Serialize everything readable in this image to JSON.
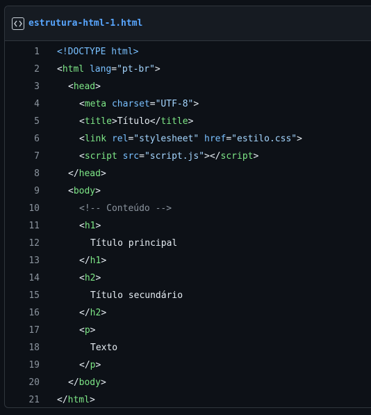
{
  "file": {
    "icon": "code-icon",
    "name": "estrutura-html-1.html"
  },
  "lines": [
    {
      "n": "1",
      "indent": 0,
      "tokens": [
        [
          "a",
          "<!DOCTYPE html>"
        ]
      ]
    },
    {
      "n": "2",
      "indent": 0,
      "tokens": [
        [
          "p",
          "<"
        ],
        [
          "t",
          "html"
        ],
        [
          "p",
          " "
        ],
        [
          "a",
          "lang"
        ],
        [
          "p",
          "="
        ],
        [
          "s",
          "\"pt-br\""
        ],
        [
          "p",
          ">"
        ]
      ]
    },
    {
      "n": "3",
      "indent": 2,
      "tokens": [
        [
          "p",
          "<"
        ],
        [
          "t",
          "head"
        ],
        [
          "p",
          ">"
        ]
      ]
    },
    {
      "n": "4",
      "indent": 4,
      "tokens": [
        [
          "p",
          "<"
        ],
        [
          "t",
          "meta"
        ],
        [
          "p",
          " "
        ],
        [
          "a",
          "charset"
        ],
        [
          "p",
          "="
        ],
        [
          "s",
          "\"UTF-8\""
        ],
        [
          "p",
          ">"
        ]
      ]
    },
    {
      "n": "5",
      "indent": 4,
      "tokens": [
        [
          "p",
          "<"
        ],
        [
          "t",
          "title"
        ],
        [
          "p",
          ">Título</"
        ],
        [
          "t",
          "title"
        ],
        [
          "p",
          ">"
        ]
      ]
    },
    {
      "n": "6",
      "indent": 4,
      "tokens": [
        [
          "p",
          "<"
        ],
        [
          "t",
          "link"
        ],
        [
          "p",
          " "
        ],
        [
          "a",
          "rel"
        ],
        [
          "p",
          "="
        ],
        [
          "s",
          "\"stylesheet\""
        ],
        [
          "p",
          " "
        ],
        [
          "a",
          "href"
        ],
        [
          "p",
          "="
        ],
        [
          "s",
          "\"estilo.css\""
        ],
        [
          "p",
          ">"
        ]
      ]
    },
    {
      "n": "7",
      "indent": 4,
      "tokens": [
        [
          "p",
          "<"
        ],
        [
          "t",
          "script"
        ],
        [
          "p",
          " "
        ],
        [
          "a",
          "src"
        ],
        [
          "p",
          "="
        ],
        [
          "s",
          "\"script.js\""
        ],
        [
          "p",
          "></"
        ],
        [
          "t",
          "script"
        ],
        [
          "p",
          ">"
        ]
      ]
    },
    {
      "n": "8",
      "indent": 2,
      "tokens": [
        [
          "p",
          "</"
        ],
        [
          "t",
          "head"
        ],
        [
          "p",
          ">"
        ]
      ]
    },
    {
      "n": "9",
      "indent": 2,
      "tokens": [
        [
          "p",
          "<"
        ],
        [
          "t",
          "body"
        ],
        [
          "p",
          ">"
        ]
      ]
    },
    {
      "n": "10",
      "indent": 4,
      "tokens": [
        [
          "c",
          "<!-- Conteúdo -->"
        ]
      ]
    },
    {
      "n": "11",
      "indent": 4,
      "tokens": [
        [
          "p",
          "<"
        ],
        [
          "t",
          "h1"
        ],
        [
          "p",
          ">"
        ]
      ]
    },
    {
      "n": "12",
      "indent": 6,
      "tokens": [
        [
          "p",
          "Título principal"
        ]
      ]
    },
    {
      "n": "13",
      "indent": 4,
      "tokens": [
        [
          "p",
          "</"
        ],
        [
          "t",
          "h1"
        ],
        [
          "p",
          ">"
        ]
      ]
    },
    {
      "n": "14",
      "indent": 4,
      "tokens": [
        [
          "p",
          "<"
        ],
        [
          "t",
          "h2"
        ],
        [
          "p",
          ">"
        ]
      ]
    },
    {
      "n": "15",
      "indent": 6,
      "tokens": [
        [
          "p",
          "Título secundário"
        ]
      ]
    },
    {
      "n": "16",
      "indent": 4,
      "tokens": [
        [
          "p",
          "</"
        ],
        [
          "t",
          "h2"
        ],
        [
          "p",
          ">"
        ]
      ]
    },
    {
      "n": "17",
      "indent": 4,
      "tokens": [
        [
          "p",
          "<"
        ],
        [
          "t",
          "p"
        ],
        [
          "p",
          ">"
        ]
      ]
    },
    {
      "n": "18",
      "indent": 6,
      "tokens": [
        [
          "p",
          "Texto"
        ]
      ]
    },
    {
      "n": "19",
      "indent": 4,
      "tokens": [
        [
          "p",
          "</"
        ],
        [
          "t",
          "p"
        ],
        [
          "p",
          ">"
        ]
      ]
    },
    {
      "n": "20",
      "indent": 2,
      "tokens": [
        [
          "p",
          "</"
        ],
        [
          "t",
          "body"
        ],
        [
          "p",
          ">"
        ]
      ]
    },
    {
      "n": "21",
      "indent": 0,
      "tokens": [
        [
          "p",
          "</"
        ],
        [
          "t",
          "html"
        ],
        [
          "p",
          ">"
        ]
      ]
    }
  ],
  "colors": {
    "background": "#0d1117",
    "header_background": "#161b22",
    "border": "#30363d",
    "file_name": "#58a6ff",
    "tag": "#7ee787",
    "attribute": "#79c0ff",
    "string": "#a5d6ff",
    "comment": "#8b949e",
    "line_number": "#8b949e",
    "text": "#e6edf3"
  }
}
